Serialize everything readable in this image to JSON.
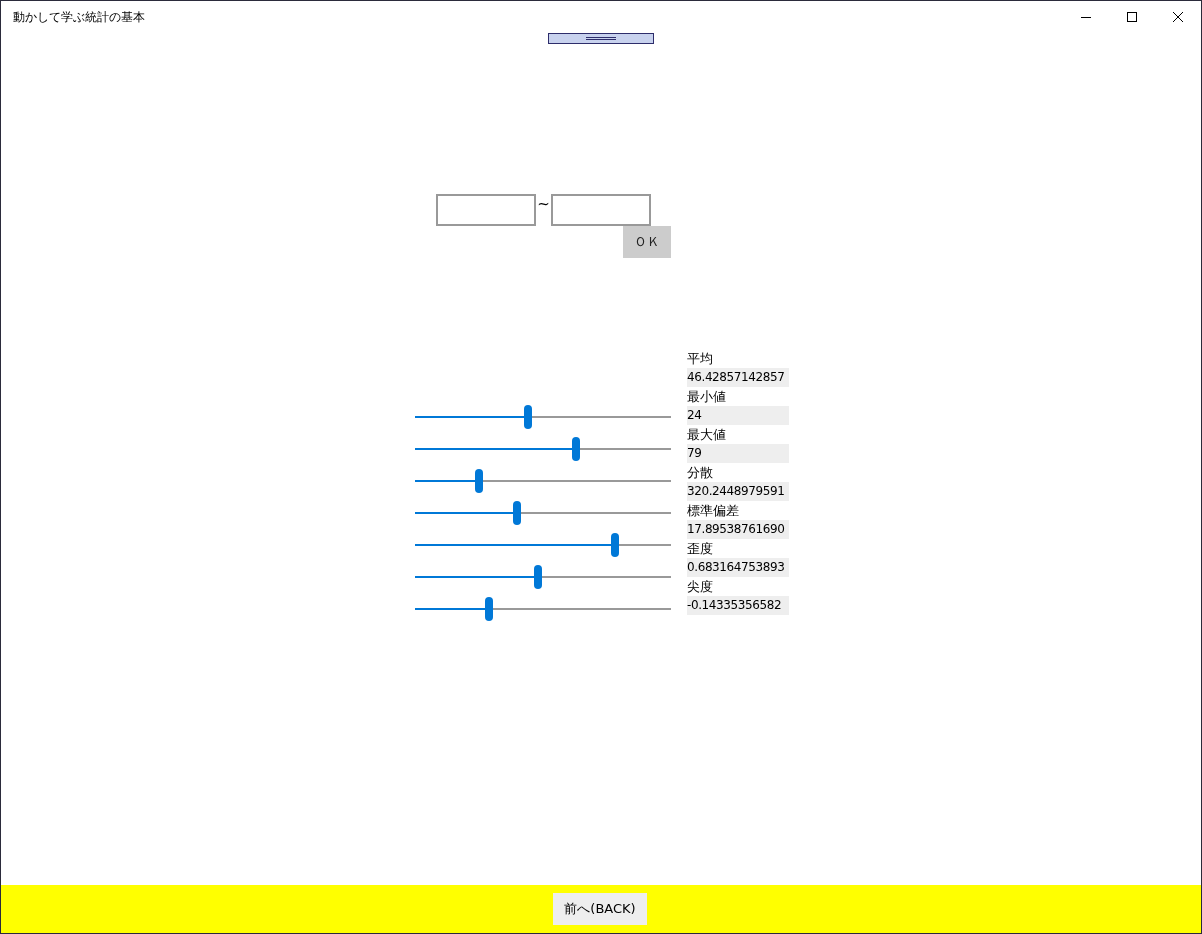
{
  "window": {
    "title": "動かして学ぶ統計の基本"
  },
  "range": {
    "separator": "~",
    "ok_button": "ＯＫ"
  },
  "sliders": [
    {
      "level": 0.44
    },
    {
      "level": 0.63
    },
    {
      "level": 0.25
    },
    {
      "level": 0.4
    },
    {
      "level": 0.78
    },
    {
      "level": 0.48
    },
    {
      "level": 0.29
    }
  ],
  "stats": [
    {
      "label": "平均",
      "value": "46.42857142857"
    },
    {
      "label": "最小値",
      "value": "24"
    },
    {
      "label": "最大値",
      "value": "79"
    },
    {
      "label": "分散",
      "value": "320.2448979591"
    },
    {
      "label": "標準偏差",
      "value": "17.89538761690"
    },
    {
      "label": "歪度",
      "value": "0.683164753893"
    },
    {
      "label": "尖度",
      "value": "-0.14335356582"
    }
  ],
  "footer": {
    "back_button": "前へ(BACK)"
  }
}
